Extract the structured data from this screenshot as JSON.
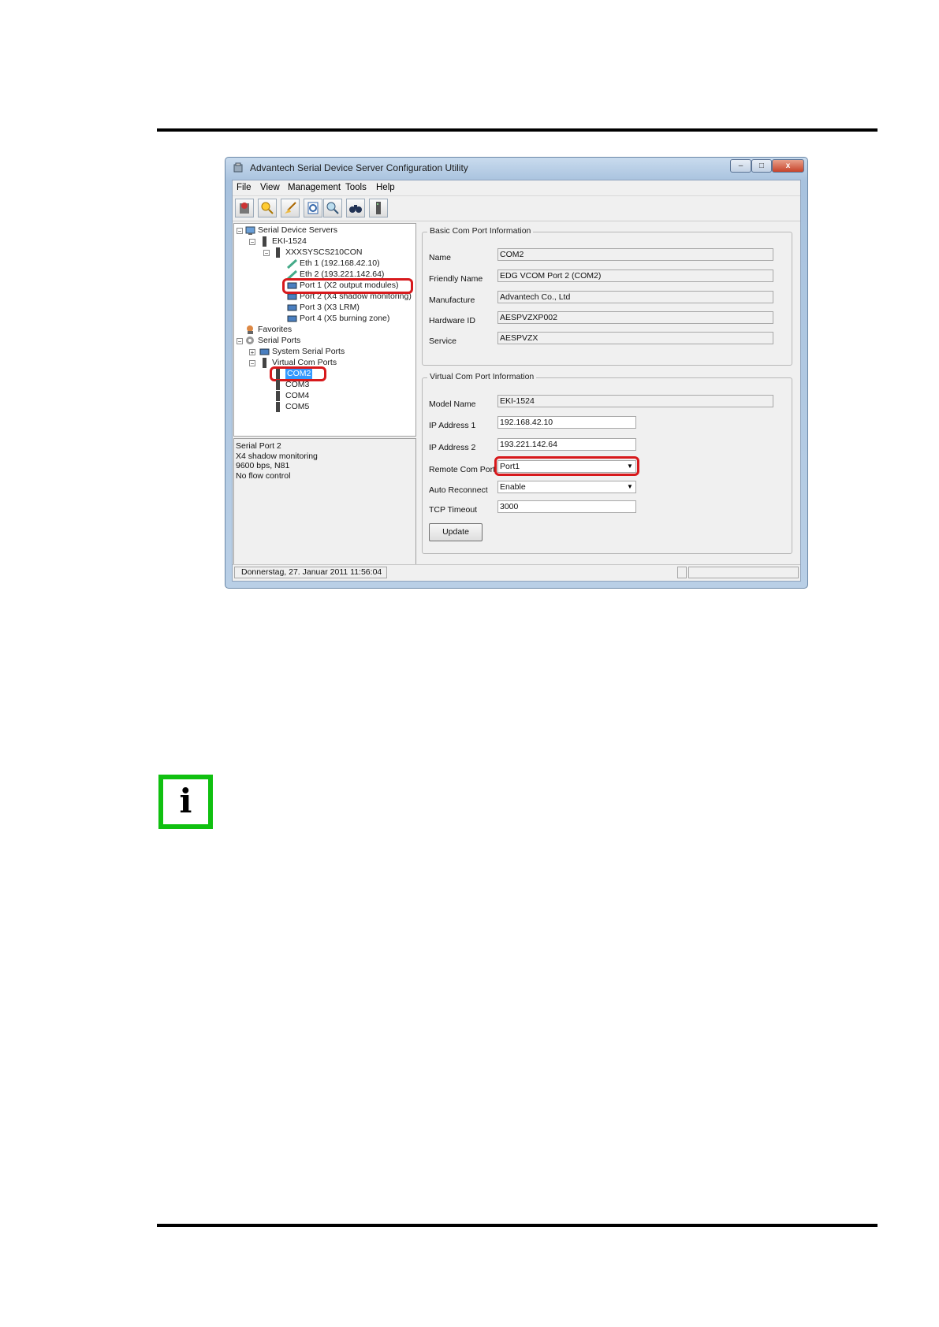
{
  "window": {
    "title": "Advantech Serial Device Server Configuration Utility",
    "buttons": {
      "minimize": "–",
      "maximize": "□",
      "close": "x"
    }
  },
  "menubar": [
    "File",
    "View",
    "Management",
    "Tools",
    "Help"
  ],
  "toolbar": [
    "add-server-icon",
    "search-icon",
    "broom-icon",
    "refresh-icon",
    "magnifier-icon",
    "binoculars-icon",
    "device-icon"
  ],
  "tree": {
    "root": "Serial Device Servers",
    "server": "EKI-1524",
    "host": "XXXSYSCS210CON",
    "eth1": "Eth 1 (192.168.42.10)",
    "eth2": "Eth 2 (193.221.142.64)",
    "port1": "Port 1 (X2 output modules)",
    "port2": "Port 2 (X4 shadow monitoring)",
    "port3": "Port 3 (X3 LRM)",
    "port4": "Port 4 (X5 burning zone)",
    "favorites": "Favorites",
    "serial_ports": "Serial Ports",
    "system_serial_ports": "System Serial Ports",
    "virtual_com_ports": "Virtual Com Ports",
    "com2": "COM2",
    "com3": "COM3",
    "com4": "COM4",
    "com5": "COM5"
  },
  "infobox": {
    "line1": "Serial Port 2",
    "line2": "X4 shadow monitoring",
    "line3": "9600 bps, N81",
    "line4": "No flow control"
  },
  "basic": {
    "title": "Basic Com Port Information",
    "name_label": "Name",
    "name": "COM2",
    "friendly_label": "Friendly Name",
    "friendly": "EDG VCOM Port 2 (COM2)",
    "manufacture_label": "Manufacture",
    "manufacture": "Advantech Co., Ltd",
    "hwid_label": "Hardware ID",
    "hwid": "AESPVZXP002",
    "service_label": "Service",
    "service": "AESPVZX"
  },
  "virtual": {
    "title": "Virtual Com Port Information",
    "model_label": "Model Name",
    "model": "EKI-1524",
    "ip1_label": "IP Address 1",
    "ip1": "192.168.42.10",
    "ip2_label": "IP Address 2",
    "ip2": "193.221.142.64",
    "remote_label": "Remote Com Port",
    "remote": "Port1",
    "reconnect_label": "Auto Reconnect",
    "reconnect": "Enable",
    "timeout_label": "TCP Timeout",
    "timeout": "3000",
    "update_label": "Update"
  },
  "status": {
    "datetime": "Donnerstag, 27. Januar 2011  11:56:04"
  },
  "colors": {
    "highlight": "#d7191c",
    "info_green": "#10c010",
    "selection": "#3399ff"
  }
}
